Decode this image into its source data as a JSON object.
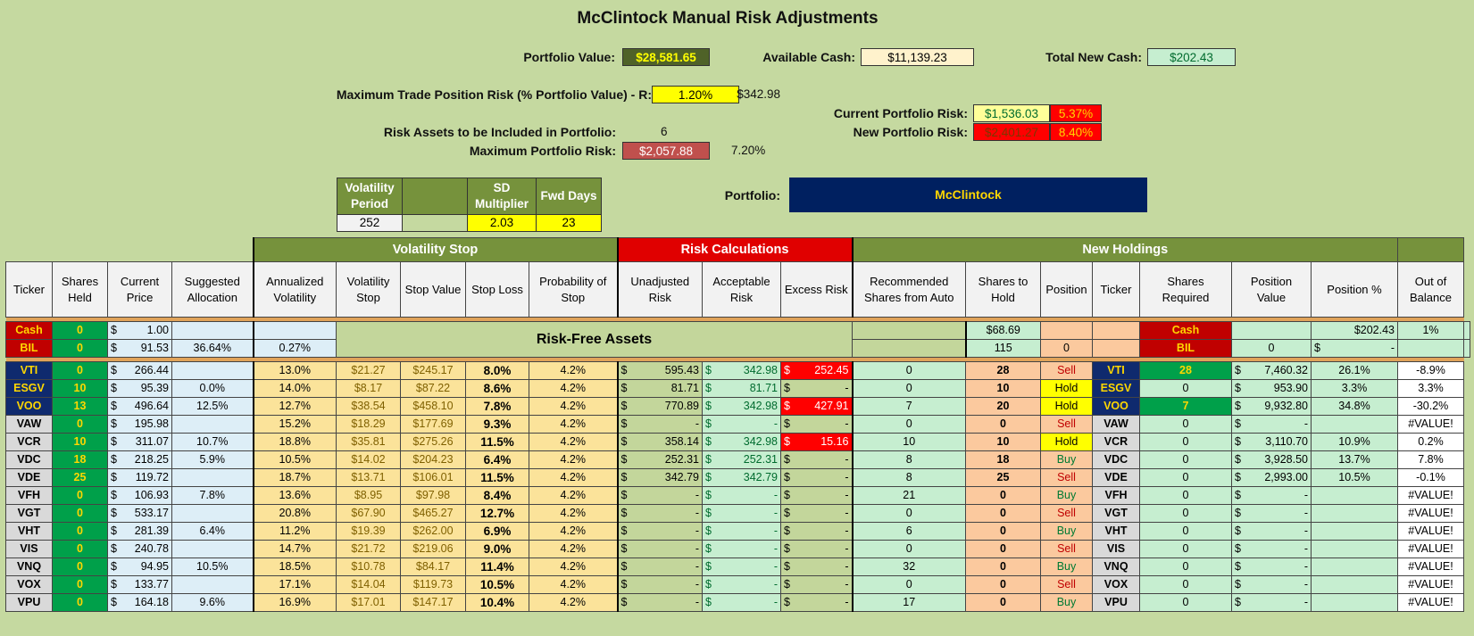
{
  "title": "McClintock Manual Risk Adjustments",
  "summary": {
    "portfolio_value_label": "Portfolio Value:",
    "portfolio_value": "$28,581.65",
    "available_cash_label": "Available Cash:",
    "available_cash": "$11,139.23",
    "total_new_cash_label": "Total New Cash:",
    "total_new_cash": "$202.43",
    "max_trade_risk_label": "Maximum Trade Position Risk (% Portfolio Value) - R:",
    "max_trade_risk_pct": "1.20%",
    "max_trade_risk_value": "$342.98",
    "risk_assets_label": "Risk Assets to be Included in Portfolio:",
    "risk_assets_count": "6",
    "max_portfolio_risk_label": "Maximum Portfolio Risk:",
    "max_portfolio_risk_value": "$2,057.88",
    "max_portfolio_risk_pct": "7.20%",
    "current_risk_label": "Current Portfolio Risk:",
    "current_risk_value": "$1,536.03",
    "current_risk_pct": "5.37%",
    "new_risk_label": "New Portfolio Risk:",
    "new_risk_value": "$2,401.27",
    "new_risk_pct": "8.40%",
    "portfolio_label": "Portfolio:",
    "portfolio_name": "McClintock"
  },
  "vol_params": {
    "period_label": "Volatility Period",
    "blank_label": "",
    "sd_label": "SD Multiplier",
    "fwd_label": "Fwd Days",
    "period_value": "252",
    "blank_value": "",
    "sd_value": "2.03",
    "fwd_value": "23"
  },
  "groups": {
    "vol_stop": "Volatility Stop",
    "risk_calc": "Risk Calculations",
    "new_holdings": "New Holdings"
  },
  "headers": [
    "Ticker",
    "Shares Held",
    "Current Price",
    "Suggested Allocation",
    "Annualized Volatility",
    "Volatility Stop",
    "Stop Value",
    "Stop Loss",
    "Probability of Stop",
    "Unadjusted Risk",
    "Acceptable Risk",
    "Excess Risk",
    "Recommended Shares from Auto",
    "Shares to Hold",
    "Position",
    "Ticker",
    "Shares Required",
    "Position Value",
    "Position %",
    "Out of Balance"
  ],
  "risk_free_label": "Risk-Free Assets",
  "risk_free": [
    {
      "ticker": "Cash",
      "shares": "0",
      "price": "1.00",
      "alloc": "",
      "vol": "",
      "rec": "$68.69",
      "hold": "",
      "pos": "",
      "ticker2": "Cash",
      "req": "",
      "value": "$202.43",
      "pct": "1%",
      "oob": ""
    },
    {
      "ticker": "BIL",
      "shares": "0",
      "price": "91.53",
      "alloc": "36.64%",
      "vol": "0.27%",
      "rec": "115",
      "hold": "0",
      "pos": "",
      "ticker2": "BIL",
      "req": "0",
      "value": "-",
      "pct": "",
      "oob": ""
    }
  ],
  "currency_symbol": "$",
  "rows": [
    {
      "ticker": "VTI",
      "shares": "0",
      "price": "266.44",
      "alloc": "",
      "vol": "13.0%",
      "vstop": "$21.27",
      "sval": "$245.17",
      "sloss": "8.0%",
      "prob": "4.2%",
      "unadj": "595.43",
      "accept": "342.98",
      "excess": "252.45",
      "rec": "0",
      "hold": "28",
      "pos": "Sell",
      "req": "28",
      "value": "7,460.32",
      "pct": "26.1%",
      "oob": "-8.9%"
    },
    {
      "ticker": "ESGV",
      "shares": "10",
      "price": "95.39",
      "alloc": "0.0%",
      "vol": "14.0%",
      "vstop": "$8.17",
      "sval": "$87.22",
      "sloss": "8.6%",
      "prob": "4.2%",
      "unadj": "81.71",
      "accept": "81.71",
      "excess": "-",
      "rec": "0",
      "hold": "10",
      "pos": "Hold",
      "req": "0",
      "value": "953.90",
      "pct": "3.3%",
      "oob": "3.3%"
    },
    {
      "ticker": "VOO",
      "shares": "13",
      "price": "496.64",
      "alloc": "12.5%",
      "vol": "12.7%",
      "vstop": "$38.54",
      "sval": "$458.10",
      "sloss": "7.8%",
      "prob": "4.2%",
      "unadj": "770.89",
      "accept": "342.98",
      "excess": "427.91",
      "rec": "7",
      "hold": "20",
      "pos": "Hold",
      "req": "7",
      "value": "9,932.80",
      "pct": "34.8%",
      "oob": "-30.2%"
    },
    {
      "ticker": "VAW",
      "shares": "0",
      "price": "195.98",
      "alloc": "",
      "vol": "15.2%",
      "vstop": "$18.29",
      "sval": "$177.69",
      "sloss": "9.3%",
      "prob": "4.2%",
      "unadj": "-",
      "accept": "-",
      "excess": "-",
      "rec": "0",
      "hold": "0",
      "pos": "Sell",
      "req": "0",
      "value": "-",
      "pct": "",
      "oob": "#VALUE!"
    },
    {
      "ticker": "VCR",
      "shares": "10",
      "price": "311.07",
      "alloc": "10.7%",
      "vol": "18.8%",
      "vstop": "$35.81",
      "sval": "$275.26",
      "sloss": "11.5%",
      "prob": "4.2%",
      "unadj": "358.14",
      "accept": "342.98",
      "excess": "15.16",
      "rec": "10",
      "hold": "10",
      "pos": "Hold",
      "req": "0",
      "value": "3,110.70",
      "pct": "10.9%",
      "oob": "0.2%"
    },
    {
      "ticker": "VDC",
      "shares": "18",
      "price": "218.25",
      "alloc": "5.9%",
      "vol": "10.5%",
      "vstop": "$14.02",
      "sval": "$204.23",
      "sloss": "6.4%",
      "prob": "4.2%",
      "unadj": "252.31",
      "accept": "252.31",
      "excess": "-",
      "rec": "8",
      "hold": "18",
      "pos": "Buy",
      "req": "0",
      "value": "3,928.50",
      "pct": "13.7%",
      "oob": "7.8%"
    },
    {
      "ticker": "VDE",
      "shares": "25",
      "price": "119.72",
      "alloc": "",
      "vol": "18.7%",
      "vstop": "$13.71",
      "sval": "$106.01",
      "sloss": "11.5%",
      "prob": "4.2%",
      "unadj": "342.79",
      "accept": "342.79",
      "excess": "-",
      "rec": "8",
      "hold": "25",
      "pos": "Sell",
      "req": "0",
      "value": "2,993.00",
      "pct": "10.5%",
      "oob": "-0.1%"
    },
    {
      "ticker": "VFH",
      "shares": "0",
      "price": "106.93",
      "alloc": "7.8%",
      "vol": "13.6%",
      "vstop": "$8.95",
      "sval": "$97.98",
      "sloss": "8.4%",
      "prob": "4.2%",
      "unadj": "-",
      "accept": "-",
      "excess": "-",
      "rec": "21",
      "hold": "0",
      "pos": "Buy",
      "req": "0",
      "value": "-",
      "pct": "",
      "oob": "#VALUE!"
    },
    {
      "ticker": "VGT",
      "shares": "0",
      "price": "533.17",
      "alloc": "",
      "vol": "20.8%",
      "vstop": "$67.90",
      "sval": "$465.27",
      "sloss": "12.7%",
      "prob": "4.2%",
      "unadj": "-",
      "accept": "-",
      "excess": "-",
      "rec": "0",
      "hold": "0",
      "pos": "Sell",
      "req": "0",
      "value": "-",
      "pct": "",
      "oob": "#VALUE!"
    },
    {
      "ticker": "VHT",
      "shares": "0",
      "price": "281.39",
      "alloc": "6.4%",
      "vol": "11.2%",
      "vstop": "$19.39",
      "sval": "$262.00",
      "sloss": "6.9%",
      "prob": "4.2%",
      "unadj": "-",
      "accept": "-",
      "excess": "-",
      "rec": "6",
      "hold": "0",
      "pos": "Buy",
      "req": "0",
      "value": "-",
      "pct": "",
      "oob": "#VALUE!"
    },
    {
      "ticker": "VIS",
      "shares": "0",
      "price": "240.78",
      "alloc": "",
      "vol": "14.7%",
      "vstop": "$21.72",
      "sval": "$219.06",
      "sloss": "9.0%",
      "prob": "4.2%",
      "unadj": "-",
      "accept": "-",
      "excess": "-",
      "rec": "0",
      "hold": "0",
      "pos": "Sell",
      "req": "0",
      "value": "-",
      "pct": "",
      "oob": "#VALUE!"
    },
    {
      "ticker": "VNQ",
      "shares": "0",
      "price": "94.95",
      "alloc": "10.5%",
      "vol": "18.5%",
      "vstop": "$10.78",
      "sval": "$84.17",
      "sloss": "11.4%",
      "prob": "4.2%",
      "unadj": "-",
      "accept": "-",
      "excess": "-",
      "rec": "32",
      "hold": "0",
      "pos": "Buy",
      "req": "0",
      "value": "-",
      "pct": "",
      "oob": "#VALUE!"
    },
    {
      "ticker": "VOX",
      "shares": "0",
      "price": "133.77",
      "alloc": "",
      "vol": "17.1%",
      "vstop": "$14.04",
      "sval": "$119.73",
      "sloss": "10.5%",
      "prob": "4.2%",
      "unadj": "-",
      "accept": "-",
      "excess": "-",
      "rec": "0",
      "hold": "0",
      "pos": "Sell",
      "req": "0",
      "value": "-",
      "pct": "",
      "oob": "#VALUE!"
    },
    {
      "ticker": "VPU",
      "shares": "0",
      "price": "164.18",
      "alloc": "9.6%",
      "vol": "16.9%",
      "vstop": "$17.01",
      "sval": "$147.17",
      "sloss": "10.4%",
      "prob": "4.2%",
      "unadj": "-",
      "accept": "-",
      "excess": "-",
      "rec": "17",
      "hold": "0",
      "pos": "Buy",
      "req": "0",
      "value": "-",
      "pct": "",
      "oob": "#VALUE!"
    }
  ],
  "colors": {
    "background": "#c5d9a0",
    "header_green": "#76923c",
    "risk_red": "#c00000",
    "navy": "#0f2a6e"
  }
}
